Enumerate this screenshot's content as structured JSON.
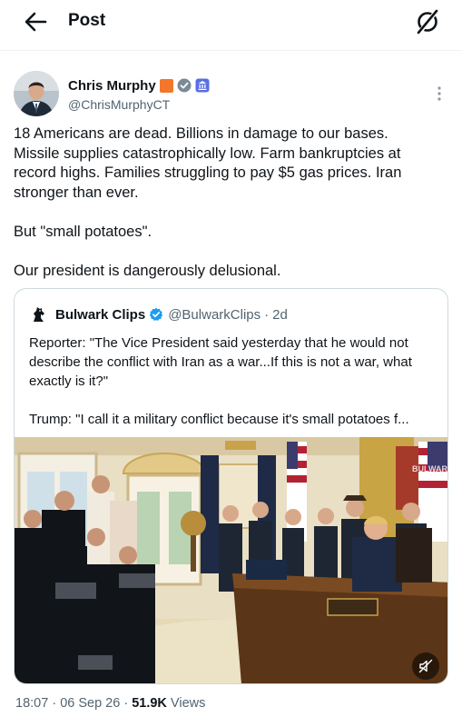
{
  "topbar": {
    "title": "Post"
  },
  "author": {
    "name": "Chris Murphy",
    "handle": "@ChrisMurphyCT"
  },
  "tweet": {
    "lines": [
      "18 Americans are dead. Billions in damage to our bases.",
      "Missile supplies catastrophically low. Farm bankruptcies at",
      "record highs. Families struggling to pay $5 gas prices. Iran",
      "stronger than ever.",
      "But \"small potatoes\".",
      "Our president is dangerously delusional."
    ]
  },
  "quote": {
    "name": "Bulwark Clips",
    "handle": "@BulwarkClips",
    "separator": "·",
    "age": "2d",
    "lines": [
      "Reporter: \"The Vice President said yesterday that he would not",
      "describe the conflict with Iran as a war...If this is not a war, what",
      "exactly is it?\"",
      "Trump: \"I call it a military conflict because it's small potatoes f..."
    ],
    "watermark": "BULWARK"
  },
  "meta": {
    "time": "18:07",
    "dot1": " · ",
    "date": "06 Sep 26",
    "dot2": " · ",
    "views_count": "51.9K",
    "views_label": " Views"
  },
  "colors": {
    "text": "#0f1419",
    "secondary": "#536471",
    "verified_blue": "#1d9bf0",
    "border": "#cfd9de",
    "badge_orange": "#f4762b"
  },
  "icons": {
    "back": "arrow-left-icon",
    "grok": "grok-icon",
    "more": "more-vertical-icon",
    "mute": "speaker-muted-icon"
  }
}
